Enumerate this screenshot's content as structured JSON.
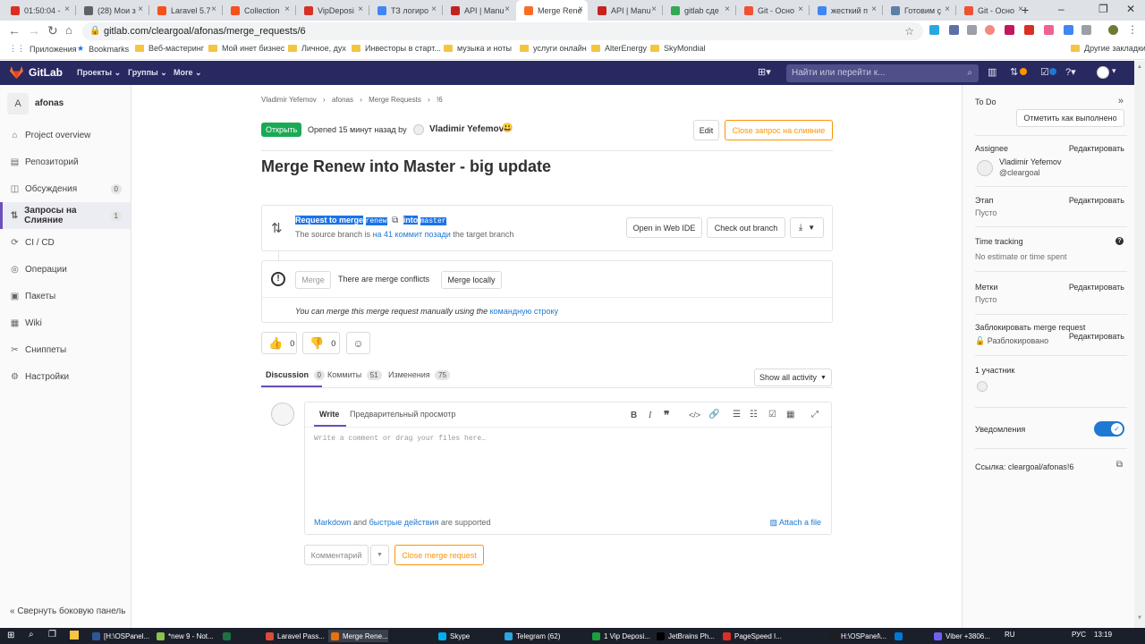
{
  "browser": {
    "tabs": [
      {
        "label": "01:50:04 -",
        "color": "#d93025"
      },
      {
        "label": "(28) Мои з",
        "color": "#5f6368"
      },
      {
        "label": "Laravel 5.7",
        "color": "#f4511e"
      },
      {
        "label": "Collection",
        "color": "#f4511e"
      },
      {
        "label": "VipDeposi",
        "color": "#d93025"
      },
      {
        "label": "ТЗ логиро",
        "color": "#4285f4"
      },
      {
        "label": "API | Manu",
        "color": "#c5221f"
      },
      {
        "label": "Merge Rene",
        "color": "#fc6d26"
      },
      {
        "label": "API | Manu",
        "color": "#c5221f"
      },
      {
        "label": "gitlab сде",
        "color": "#34a853"
      },
      {
        "label": "Git - Осно",
        "color": "#f05133"
      },
      {
        "label": "жесткий п",
        "color": "#4285f4"
      },
      {
        "label": "Готовим ç",
        "color": "#5f7fa8"
      },
      {
        "label": "Git - Осно",
        "color": "#f05133"
      }
    ],
    "new_tab": "+",
    "url": "gitlab.com/cleargoal/afonas/merge_requests/6",
    "bookmarks": [
      "Приложения",
      "Bookmarks",
      "Веб-мастеринг",
      "Мой инет бизнес",
      "Личное, дух",
      "Инвесторы в старт...",
      "музыка и ноты",
      "услуги онлайн",
      "AlterEnergy",
      "SkyMondial"
    ],
    "other_bookmarks": "Другие закладки"
  },
  "gitlab_nav": {
    "logo": "GitLab",
    "menus": [
      "Проекты ⌄",
      "Группы ⌄",
      "More ⌄"
    ],
    "search_placeholder": "Найти или перейти к..."
  },
  "sidebar": {
    "project_initial": "A",
    "project_name": "afonas",
    "items": [
      {
        "label": "Project overview",
        "icon": "⌂"
      },
      {
        "label": "Репозиторий",
        "icon": "▤"
      },
      {
        "label": "Обсуждения",
        "icon": "◫",
        "badge": "0"
      },
      {
        "label": "Запросы на Слияние",
        "icon": "⇅",
        "badge": "1"
      },
      {
        "label": "CI / CD",
        "icon": "⟳"
      },
      {
        "label": "Операции",
        "icon": "◎"
      },
      {
        "label": "Пакеты",
        "icon": "▣"
      },
      {
        "label": "Wiki",
        "icon": "▦"
      },
      {
        "label": "Сниппеты",
        "icon": "✂"
      },
      {
        "label": "Настройки",
        "icon": "⚙"
      }
    ],
    "collapse_label": "Свернуть боковую панель"
  },
  "mr": {
    "breadcrumb": [
      "Vladimir Yefemov",
      "afonas",
      "Merge Requests",
      "!6"
    ],
    "status": "Открыть",
    "opened_text": "Opened 15 минут назад by",
    "author": "Vladimir Yefemov",
    "author_emoji": "😃",
    "edit_label": "Edit",
    "close_label": "Close запрос на слияние",
    "title": "Merge Renew into Master - big update",
    "request_to_merge": "Request to merge",
    "source_branch": "renew",
    "into": "into",
    "target_branch": "master",
    "behind_prefix": "The source branch is",
    "behind_link": "на 41 коммит позади",
    "behind_suffix": "the target branch",
    "open_web_ide": "Open in Web IDE",
    "checkout_branch": "Check out branch",
    "merge_button": "Merge",
    "conflict_text": "There are merge conflicts",
    "merge_locally": "Merge locally",
    "manual_text": "You can merge this merge request manually using the",
    "manual_link": "командную строку",
    "thumbs_up": "0",
    "thumbs_down": "0"
  },
  "tabs": {
    "discussion": "Discussion",
    "discussion_count": "0",
    "commits": "Коммиты",
    "commits_count": "51",
    "changes": "Изменения",
    "changes_count": "75",
    "show_activity": "Show all activity"
  },
  "editor": {
    "write_tab": "Write",
    "preview_tab": "Предварительный просмотр",
    "placeholder": "Write a comment or drag your files here…",
    "markdown": "Markdown",
    "and": "and",
    "quick_actions": "быстрые действия",
    "supported": "are supported",
    "attach": "Attach a file",
    "comment_button": "Комментарий",
    "close_mr": "Close merge request"
  },
  "right_sidebar": {
    "todo": "To Do",
    "mark_done": "Отметить как выполнено",
    "assignee_label": "Assignee",
    "edit": "Редактировать",
    "assignee_name": "Vladimir Yefemov",
    "assignee_handle": "@cleargoal",
    "milestone_label": "Этап",
    "empty": "Пусто",
    "time_tracking": "Time tracking",
    "time_value": "No estimate or time spent",
    "labels_label": "Метки",
    "lock_label": "Заблокировать merge request",
    "lock_value": "Разблокировано",
    "participants": "1 участник",
    "notifications": "Уведомления",
    "reference": "Ссылка: cleargoal/afonas!6"
  },
  "taskbar": {
    "items": [
      "[H:\\OSPanel...",
      "*new 9 - Not...",
      "",
      "Laravel Pass...",
      "Merge Rene...",
      "Skype",
      "Telegram (62)",
      "1 Vip Deposi...",
      "JetBrains Ph...",
      "PageSpeed I...",
      "H:\\OSPanel\\...",
      "",
      "Viber +3806..."
    ],
    "lang": "RU",
    "lang2": "РУС",
    "time": "13:19"
  },
  "colors": {
    "gitlab_nav": "#292961",
    "open_badge": "#1aaa55",
    "close_btn": "#fc9403",
    "link": "#1f78d1",
    "toggle": "#1f78d1"
  }
}
